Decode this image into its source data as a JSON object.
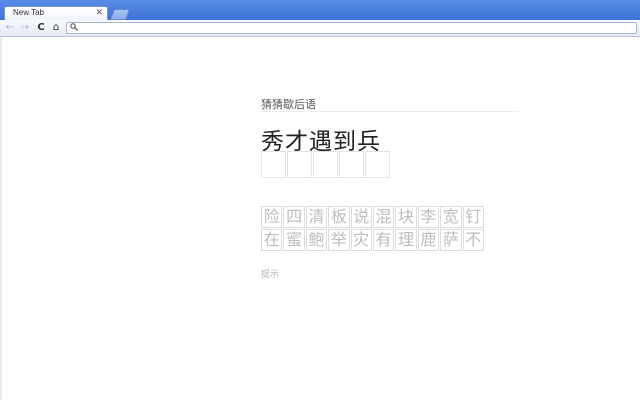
{
  "browser": {
    "tab_title": "New Tab",
    "close_glyph": "✕",
    "back_glyph": "←",
    "forward_glyph": "→",
    "reload_glyph": "C",
    "home_glyph": "⌂",
    "search_glyph": "🔍"
  },
  "game": {
    "subtitle": "猜猜歇后语",
    "question": "秀才遇到兵",
    "answer_slots": 5,
    "candidates": [
      "险",
      "四",
      "清",
      "板",
      "说",
      "混",
      "块",
      "李",
      "宽",
      "钉",
      "在",
      "蜜",
      "鲍",
      "举",
      "灾",
      "有",
      "理",
      "鹿",
      "萨",
      "不"
    ],
    "hint_label": "提示"
  }
}
